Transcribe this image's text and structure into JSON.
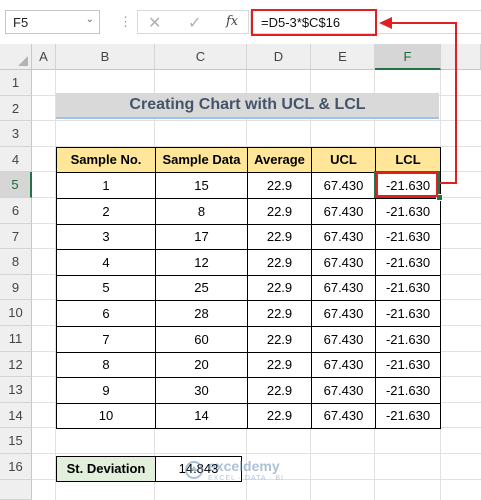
{
  "formula_bar": {
    "name_box": "F5",
    "name_box_dropdown_glyph": "⌄",
    "separator_glyph": "⋮",
    "cancel_glyph": "✕",
    "enter_glyph": "✓",
    "fx_label": "fx",
    "formula": "=D5-3*$C$16"
  },
  "columns": [
    "A",
    "B",
    "C",
    "D",
    "E",
    "F"
  ],
  "rows": [
    "1",
    "2",
    "3",
    "4",
    "5",
    "6",
    "7",
    "8",
    "9",
    "10",
    "11",
    "12",
    "13",
    "14",
    "15",
    "16"
  ],
  "selected": {
    "column": "F",
    "row": "5"
  },
  "title": "Creating Chart with UCL & LCL",
  "table": {
    "headers": [
      "Sample No.",
      "Sample Data",
      "Average",
      "UCL",
      "LCL"
    ],
    "rows": [
      [
        "1",
        "15",
        "22.9",
        "67.430",
        "-21.630"
      ],
      [
        "2",
        "8",
        "22.9",
        "67.430",
        "-21.630"
      ],
      [
        "3",
        "17",
        "22.9",
        "67.430",
        "-21.630"
      ],
      [
        "4",
        "12",
        "22.9",
        "67.430",
        "-21.630"
      ],
      [
        "5",
        "25",
        "22.9",
        "67.430",
        "-21.630"
      ],
      [
        "6",
        "28",
        "22.9",
        "67.430",
        "-21.630"
      ],
      [
        "7",
        "60",
        "22.9",
        "67.430",
        "-21.630"
      ],
      [
        "8",
        "20",
        "22.9",
        "67.430",
        "-21.630"
      ],
      [
        "9",
        "30",
        "22.9",
        "67.430",
        "-21.630"
      ],
      [
        "10",
        "14",
        "22.9",
        "67.430",
        "-21.630"
      ]
    ]
  },
  "st_deviation": {
    "label": "St. Deviation",
    "value": "14.843"
  },
  "watermark": {
    "brand": "exceldemy",
    "tagline": "EXCEL · DATA · BI"
  },
  "colors": {
    "header_fill": "#ffe699",
    "label_fill": "#e2efda",
    "title_fill": "#d9d9d9",
    "title_text": "#44546a",
    "highlight_red": "#e02020",
    "selection_green": "#217346"
  }
}
